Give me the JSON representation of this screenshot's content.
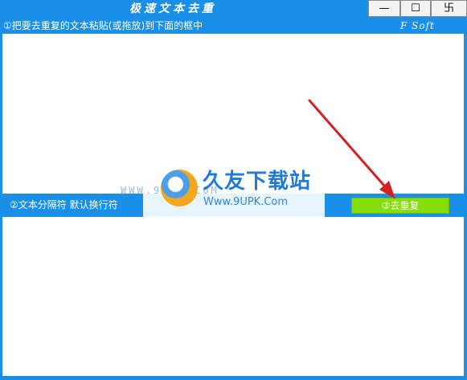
{
  "window": {
    "title": "极速文本去重",
    "min_symbol": "—",
    "max_symbol": "☐",
    "close_symbol": "卐"
  },
  "header": {
    "instruction": "①把要去重复的文本粘贴(或拖放)到下面的框中",
    "brand": "F Soft"
  },
  "input": {
    "value": "",
    "placeholder": ""
  },
  "options": {
    "separator_label": "②文本分隔符  默认换行符",
    "dedup_button": "③去重复"
  },
  "output": {
    "value": ""
  },
  "watermark": {
    "cn_text": "久友下载站",
    "url": "Www.9UPK.Com",
    "side_text": "WWW.9UPK.COM"
  },
  "colors": {
    "frame": "#1a8fe8",
    "button_green": "#86dd0c",
    "arrow_red": "#d32020"
  },
  "icons": [
    "minimize-icon",
    "maximize-icon",
    "close-icon",
    "red-arrow-annotation"
  ]
}
